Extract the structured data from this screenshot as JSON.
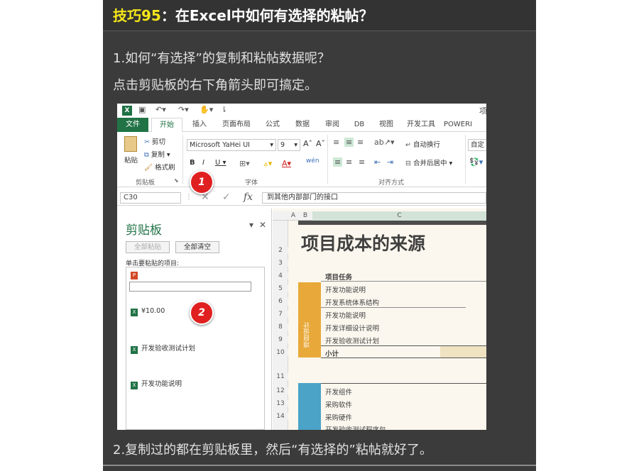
{
  "title": {
    "highlight": "技巧95",
    "rest": "：在Excel中如何有选择的粘帖？"
  },
  "step1_question": "1.如何“有选择”的复制和粘帖数据呢？",
  "step1_answer": "点击剪贴板的右下角箭头即可搞定。",
  "step2_text": "2.复制过的都在剪贴板里，然后“有选择的”粘帖就好了。",
  "excel": {
    "title_fragment": "项",
    "tabs": [
      "文件",
      "开始",
      "插入",
      "页面布局",
      "公式",
      "数据",
      "审阅",
      "DB",
      "视图",
      "开发工具",
      "POWERI"
    ],
    "clipboard_group": {
      "paste": "粘贴",
      "cut": "剪切",
      "copy": "复制",
      "format_painter": "格式刷",
      "label": "剪贴板"
    },
    "font_group": {
      "font": "Microsoft YaHei UI",
      "size": "9",
      "label": "字体"
    },
    "align_group": {
      "wrap": "自动换行",
      "merge": "合并后居中",
      "label": "对齐方式"
    },
    "number_format": "自定",
    "name_box": "C30",
    "formula_value": "到其他内部部门的接口",
    "clipboard_pane": {
      "title": "剪贴板",
      "paste_all": "全部粘贴",
      "clear_all": "全部清空",
      "hint": "单击要粘贴的项目:",
      "items": [
        "¥10.00",
        "开发验收测试计划",
        "开发功能说明"
      ]
    },
    "sheet": {
      "columns": [
        "A",
        "B",
        "C"
      ],
      "rows": [
        "2",
        "3",
        "4",
        "5",
        "6",
        "7",
        "8",
        "9",
        "10",
        "11",
        "12",
        "13",
        "14"
      ],
      "heading": "项目成本的来源",
      "col_title": "项目任务",
      "tasks_a": [
        "开发功能说明",
        "开发系统体系结构",
        "开发功能说明",
        "开发详细设计说明",
        "开发验收测试计划"
      ],
      "subtotal": "小计",
      "band_label": "项目设计",
      "tasks_b": [
        "开发组件",
        "采购软件",
        "采购硬件",
        "开发验收测试程序包"
      ]
    },
    "badges": [
      "1",
      "2"
    ]
  }
}
